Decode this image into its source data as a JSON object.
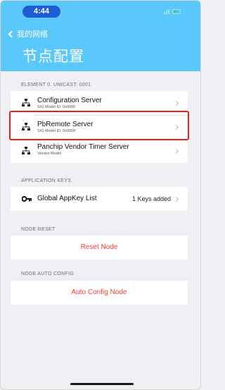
{
  "status_bar": {
    "time": "4:44"
  },
  "nav": {
    "back_label": "我的网络",
    "title": "节点配置"
  },
  "element_section": {
    "header": "ELEMENT 0. UNICAST: 0001",
    "items": [
      {
        "title": "Configuration Server",
        "subtitle": "SIG Model ID: 0x0000"
      },
      {
        "title": "PbRemote Server",
        "subtitle": "SIG Model ID: 0x0004"
      },
      {
        "title": "Panchip Vendor Timer Server",
        "subtitle": "Vendor Model"
      }
    ]
  },
  "app_keys_section": {
    "header": "APPLICATION KEYS",
    "item": {
      "title": "Global AppKey List",
      "detail": "1 Keys added"
    }
  },
  "node_reset_section": {
    "header": "NODE RESET",
    "action": "Reset Node"
  },
  "node_auto_config_section": {
    "header": "NODE AUTO CONFIG",
    "action": "Auto Config Node"
  },
  "colors": {
    "header_bg": "#5ac8fa",
    "destructive": "#ff3b30",
    "highlight": "#e8201c"
  },
  "icons": {
    "back": "chevron-left-icon",
    "model": "network-node-icon",
    "key": "key-icon",
    "disclosure": "chevron-right-icon"
  }
}
